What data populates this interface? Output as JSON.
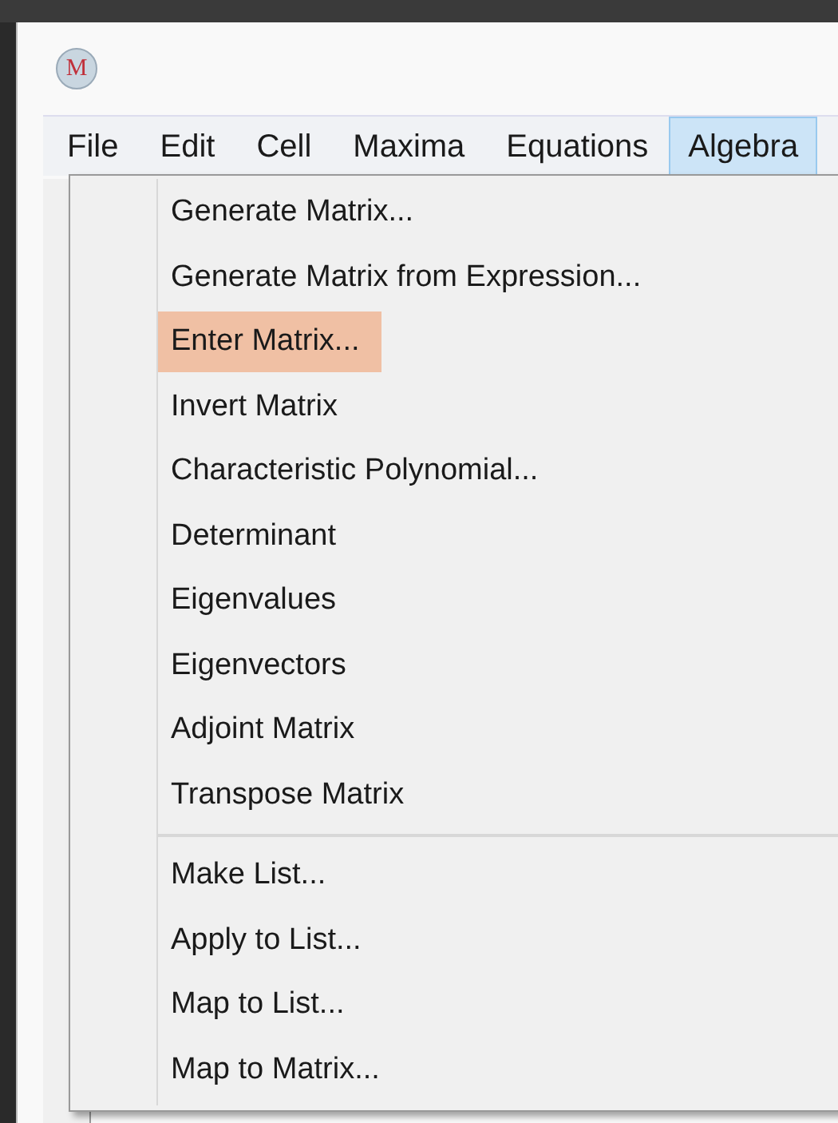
{
  "window": {
    "logo_text": "M"
  },
  "menu_bar": [
    {
      "label": "File",
      "selected": false
    },
    {
      "label": "Edit",
      "selected": false
    },
    {
      "label": "Cell",
      "selected": false
    },
    {
      "label": "Maxima",
      "selected": false
    },
    {
      "label": "Equations",
      "selected": false
    },
    {
      "label": "Algebra",
      "selected": true
    }
  ],
  "dropdown": {
    "groups": [
      [
        {
          "label": "Generate Matrix...",
          "selected": false
        },
        {
          "label": "Generate Matrix from Expression...",
          "selected": false
        },
        {
          "label": "Enter Matrix...",
          "selected": true
        },
        {
          "label": "Invert Matrix",
          "selected": false
        },
        {
          "label": "Characteristic Polynomial...",
          "selected": false
        },
        {
          "label": "Determinant",
          "selected": false
        },
        {
          "label": "Eigenvalues",
          "selected": false
        },
        {
          "label": "Eigenvectors",
          "selected": false
        },
        {
          "label": "Adjoint Matrix",
          "selected": false
        },
        {
          "label": "Transpose Matrix",
          "selected": false
        }
      ],
      [
        {
          "label": "Make List...",
          "selected": false
        },
        {
          "label": "Apply to List...",
          "selected": false
        },
        {
          "label": "Map to List...",
          "selected": false
        },
        {
          "label": "Map to Matrix...",
          "selected": false
        }
      ]
    ]
  }
}
